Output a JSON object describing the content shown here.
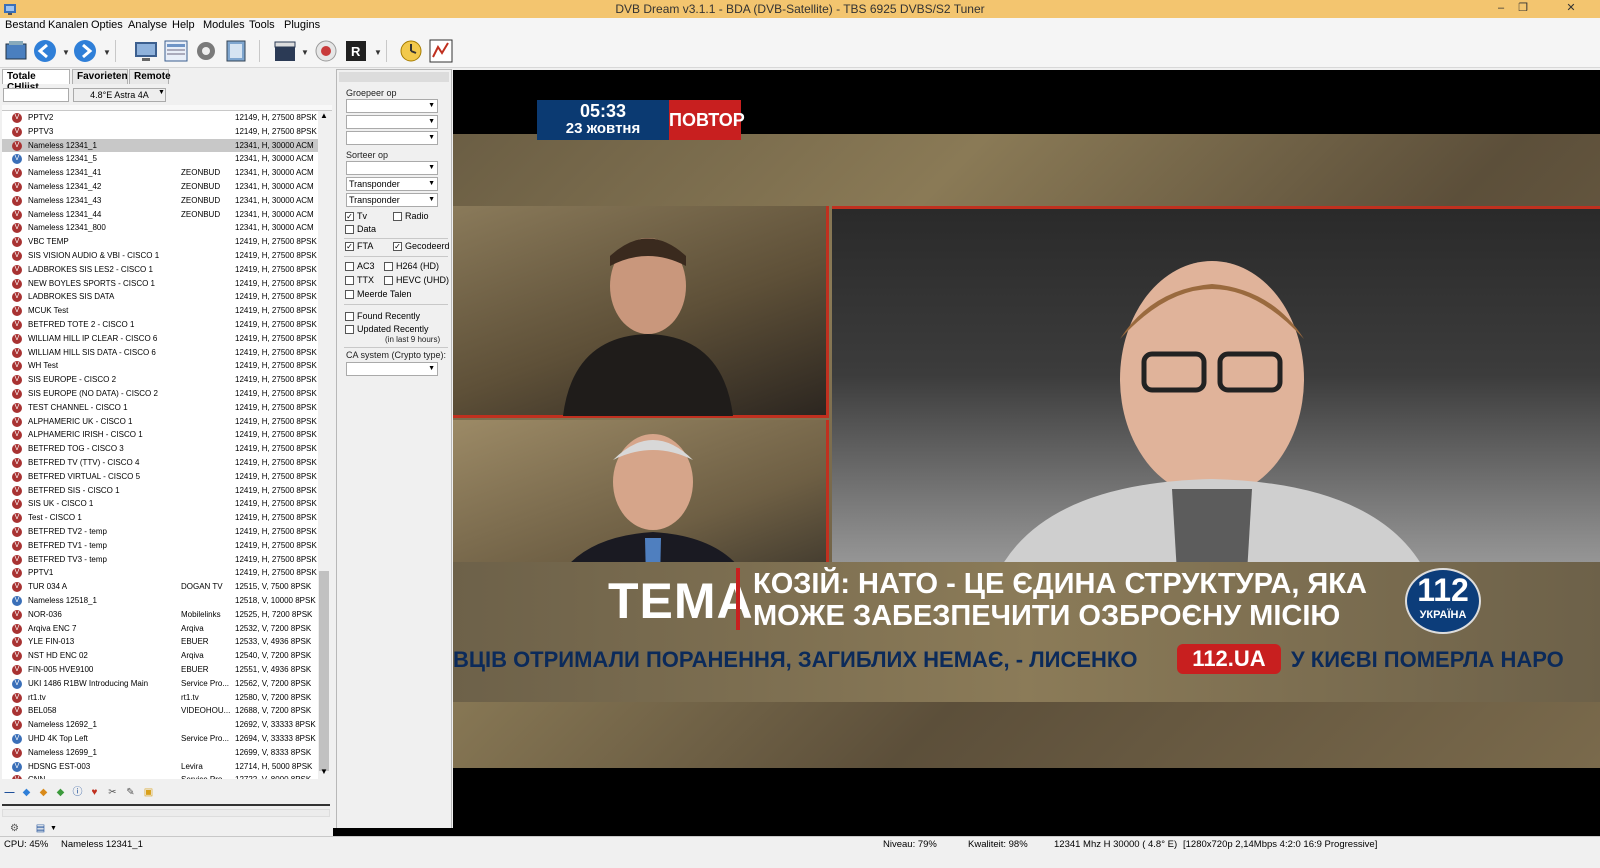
{
  "window": {
    "title": "DVB Dream v3.1.1 - BDA (DVB-Satellite)  -  TBS 6925 DVBS/S2 Tuner",
    "minimize": "–",
    "restore": "❐",
    "close": "✕"
  },
  "menu": [
    "Bestand",
    "Kanalen",
    "Opties",
    "Analyse",
    "Help",
    "Modules",
    "Tools",
    "Plugins"
  ],
  "tabs": [
    "Totale CHlijst",
    "Favorieten",
    "Remote"
  ],
  "satellite_select": "4.8°E Astra 4A",
  "channels": [
    {
      "name": "PPTV2",
      "provider": "",
      "freq": "12149, H, 27500 8PSK",
      "icon": "red"
    },
    {
      "name": "PPTV3",
      "provider": "",
      "freq": "12149, H, 27500 8PSK",
      "icon": "red"
    },
    {
      "name": "Nameless 12341_1",
      "provider": "",
      "freq": "12341, H, 30000 ACM",
      "icon": "red",
      "selected": true
    },
    {
      "name": "Nameless 12341_5",
      "provider": "",
      "freq": "12341, H, 30000 ACM",
      "icon": "blue"
    },
    {
      "name": "Nameless 12341_41",
      "provider": "ZEONBUD",
      "freq": "12341, H, 30000 ACM",
      "icon": "red"
    },
    {
      "name": "Nameless 12341_42",
      "provider": "ZEONBUD",
      "freq": "12341, H, 30000 ACM",
      "icon": "red"
    },
    {
      "name": "Nameless 12341_43",
      "provider": "ZEONBUD",
      "freq": "12341, H, 30000 ACM",
      "icon": "red"
    },
    {
      "name": "Nameless 12341_44",
      "provider": "ZEONBUD",
      "freq": "12341, H, 30000 ACM",
      "icon": "red"
    },
    {
      "name": "Nameless 12341_800",
      "provider": "",
      "freq": "12341, H, 30000 ACM",
      "icon": "red"
    },
    {
      "name": "VBC TEMP",
      "provider": "",
      "freq": "12419, H, 27500 8PSK",
      "icon": "red"
    },
    {
      "name": "SIS VISION AUDIO & VBI - CISCO 1",
      "provider": "",
      "freq": "12419, H, 27500 8PSK",
      "icon": "red"
    },
    {
      "name": "LADBROKES SIS LES2 - CISCO 1",
      "provider": "",
      "freq": "12419, H, 27500 8PSK",
      "icon": "red"
    },
    {
      "name": "NEW BOYLES SPORTS - CISCO 1",
      "provider": "",
      "freq": "12419, H, 27500 8PSK",
      "icon": "red"
    },
    {
      "name": "LADBROKES SIS DATA",
      "provider": "",
      "freq": "12419, H, 27500 8PSK",
      "icon": "red"
    },
    {
      "name": "MCUK Test",
      "provider": "",
      "freq": "12419, H, 27500 8PSK",
      "icon": "red"
    },
    {
      "name": "BETFRED TOTE 2 - CISCO 1",
      "provider": "",
      "freq": "12419, H, 27500 8PSK",
      "icon": "red"
    },
    {
      "name": "WILLIAM HILL IP CLEAR - CISCO 6",
      "provider": "",
      "freq": "12419, H, 27500 8PSK",
      "icon": "red"
    },
    {
      "name": "WILLIAM HILL SIS DATA - CISCO 6",
      "provider": "",
      "freq": "12419, H, 27500 8PSK",
      "icon": "red"
    },
    {
      "name": "WH Test",
      "provider": "",
      "freq": "12419, H, 27500 8PSK",
      "icon": "red"
    },
    {
      "name": "SIS EUROPE - CISCO 2",
      "provider": "",
      "freq": "12419, H, 27500 8PSK",
      "icon": "red"
    },
    {
      "name": "SIS EUROPE (NO DATA) - CISCO 2",
      "provider": "",
      "freq": "12419, H, 27500 8PSK",
      "icon": "red"
    },
    {
      "name": "TEST CHANNEL - CISCO 1",
      "provider": "",
      "freq": "12419, H, 27500 8PSK",
      "icon": "red"
    },
    {
      "name": "ALPHAMERIC UK - CISCO 1",
      "provider": "",
      "freq": "12419, H, 27500 8PSK",
      "icon": "red"
    },
    {
      "name": "ALPHAMERIC IRISH - CISCO 1",
      "provider": "",
      "freq": "12419, H, 27500 8PSK",
      "icon": "red"
    },
    {
      "name": "BETFRED TOG - CISCO 3",
      "provider": "",
      "freq": "12419, H, 27500 8PSK",
      "icon": "red"
    },
    {
      "name": "BETFRED TV (TTV) - CISCO 4",
      "provider": "",
      "freq": "12419, H, 27500 8PSK",
      "icon": "red"
    },
    {
      "name": "BETFRED VIRTUAL - CISCO 5",
      "provider": "",
      "freq": "12419, H, 27500 8PSK",
      "icon": "red"
    },
    {
      "name": "BETFRED SIS - CISCO 1",
      "provider": "",
      "freq": "12419, H, 27500 8PSK",
      "icon": "red"
    },
    {
      "name": "SIS UK - CISCO 1",
      "provider": "",
      "freq": "12419, H, 27500 8PSK",
      "icon": "red"
    },
    {
      "name": "Test - CISCO 1",
      "provider": "",
      "freq": "12419, H, 27500 8PSK",
      "icon": "red"
    },
    {
      "name": "BETFRED TV2 - temp",
      "provider": "",
      "freq": "12419, H, 27500 8PSK",
      "icon": "red"
    },
    {
      "name": "BETFRED TV1 - temp",
      "provider": "",
      "freq": "12419, H, 27500 8PSK",
      "icon": "red"
    },
    {
      "name": "BETFRED TV3 - temp",
      "provider": "",
      "freq": "12419, H, 27500 8PSK",
      "icon": "red"
    },
    {
      "name": "PPTV1",
      "provider": "",
      "freq": "12419, H, 27500 8PSK",
      "icon": "red"
    },
    {
      "name": "TUR 034 A",
      "provider": "DOGAN TV",
      "freq": "12515, V, 7500 8PSK",
      "icon": "red"
    },
    {
      "name": "Nameless 12518_1",
      "provider": "",
      "freq": "12518, V, 10000 8PSK",
      "icon": "blue"
    },
    {
      "name": "NOR-036",
      "provider": "Mobilelinks",
      "freq": "12525, H, 7200 8PSK",
      "icon": "red"
    },
    {
      "name": "Arqiva ENC 7",
      "provider": "Arqiva",
      "freq": "12532, V, 7200 8PSK",
      "icon": "red"
    },
    {
      "name": "YLE FIN-013",
      "provider": "EBUER",
      "freq": "12533, V, 4936 8PSK",
      "icon": "red"
    },
    {
      "name": "NST HD ENC 02",
      "provider": "Arqiva",
      "freq": "12540, V, 7200 8PSK",
      "icon": "red"
    },
    {
      "name": "FIN-005 HVE9100",
      "provider": "EBUER",
      "freq": "12551, V, 4936 8PSK",
      "icon": "red"
    },
    {
      "name": "UKI 1486 R1BW Introducing Main",
      "provider": "Service Pro...",
      "freq": "12562, V, 7200 8PSK",
      "icon": "blue"
    },
    {
      "name": "rt1.tv",
      "provider": "rt1.tv",
      "freq": "12580, V, 7200 8PSK",
      "icon": "red"
    },
    {
      "name": "BEL058",
      "provider": "VIDEOHOU...",
      "freq": "12688, V, 7200 8PSK",
      "icon": "red"
    },
    {
      "name": "Nameless 12692_1",
      "provider": "",
      "freq": "12692, V, 33333 8PSK",
      "icon": "red"
    },
    {
      "name": "UHD 4K Top Left",
      "provider": "Service Pro...",
      "freq": "12694, V, 33333 8PSK",
      "icon": "blue"
    },
    {
      "name": "Nameless 12699_1",
      "provider": "",
      "freq": "12699, V, 8333 8PSK",
      "icon": "red"
    },
    {
      "name": "HDSNG EST-003",
      "provider": "Levira",
      "freq": "12714, H, 5000 8PSK",
      "icon": "blue"
    },
    {
      "name": "CNN",
      "provider": "Service Pro...",
      "freq": "12722, V, 8000 8PSK",
      "icon": "red"
    }
  ],
  "filters": {
    "group_label": "Groepeer op",
    "sort_label": "Sorteer op",
    "sort1": "Transponder",
    "sort2": "Transponder",
    "tv": "Tv",
    "radio": "Radio",
    "data": "Data",
    "fta": "FTA",
    "coded": "Gecodeerd",
    "ac3": "AC3",
    "h264": "H264 (HD)",
    "ttx": "TTX",
    "hevc": "HEVC (UHD)",
    "multi_lang": "Meerde Talen",
    "found_recently": "Found Recently",
    "updated_recently": "Updated Recently",
    "updated_note": "(in last 9 hours)",
    "ca_label": "CA system (Crypto type):"
  },
  "video": {
    "clock": "05:33",
    "date": "23 жовтня",
    "repeat": "ПОВТОР",
    "tema": "ТЕМА",
    "headline1": "КОЗІЙ: НАТО - ЦЕ ЄДИНА СТРУКТУРА, ЯКА",
    "headline2": "МОЖЕ ЗАБЕЗПЕЧИТИ ОЗБРОЄНУ МІСІЮ",
    "logo_num": "112",
    "logo_sub": "УКРАЇНА",
    "ticker1": "ВЦІВ ОТРИМАЛИ ПОРАНЕННЯ, ЗАГИБЛИХ НЕМАЄ, - ЛИСЕНКО",
    "ticker_badge": "112.UA",
    "ticker2": "У КИЄВІ ПОМЕРЛА НАРО"
  },
  "status": {
    "cpu": "CPU: 45%",
    "channel": "Nameless 12341_1",
    "level": "Niveau: 79%",
    "quality": "Kwaliteit: 98%",
    "tuning": "12341 Mhz  H  30000  ( 4.8° E)",
    "format": "[1280x720p  2,14Mbps 4:2:0  16:9 Progressive]"
  }
}
